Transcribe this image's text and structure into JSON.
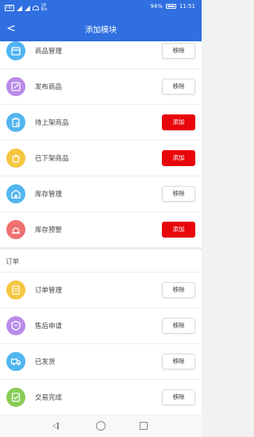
{
  "status_bar": {
    "left_label": "HD",
    "net_speed_value": "18",
    "net_speed_unit": "B/s",
    "battery": "94%",
    "time": "11:51"
  },
  "header": {
    "back_symbol": "<",
    "title": "添加模块"
  },
  "rows_top": [
    {
      "label": "商品管理",
      "button": "移除",
      "action": "remove",
      "color": "#4fb3f2",
      "icon": "box-icon"
    },
    {
      "label": "发布商品",
      "button": "移除",
      "action": "remove",
      "color": "#b98be8",
      "icon": "edit-icon"
    },
    {
      "label": "待上架商品",
      "button": "添加",
      "action": "add",
      "color": "#52b6f0",
      "icon": "clipboard-icon"
    },
    {
      "label": "已下架商品",
      "button": "添加",
      "action": "add",
      "color": "#f6c640",
      "icon": "bag-icon"
    },
    {
      "label": "库存管理",
      "button": "移除",
      "action": "remove",
      "color": "#52b6f0",
      "icon": "warehouse-icon"
    },
    {
      "label": "库存预警",
      "button": "添加",
      "action": "add",
      "color": "#f07070",
      "icon": "alarm-icon"
    }
  ],
  "section": {
    "title": "订单"
  },
  "rows_bottom": [
    {
      "label": "订单管理",
      "button": "移除",
      "action": "remove",
      "color": "#f6c640",
      "icon": "order-icon"
    },
    {
      "label": "售后申请",
      "button": "移除",
      "action": "remove",
      "color": "#b98be8",
      "icon": "shield-icon"
    },
    {
      "label": "已发货",
      "button": "移除",
      "action": "remove",
      "color": "#52b6f0",
      "icon": "truck-icon"
    },
    {
      "label": "交易完成",
      "button": "移除",
      "action": "remove",
      "color": "#88cc55",
      "icon": "done-icon"
    }
  ]
}
